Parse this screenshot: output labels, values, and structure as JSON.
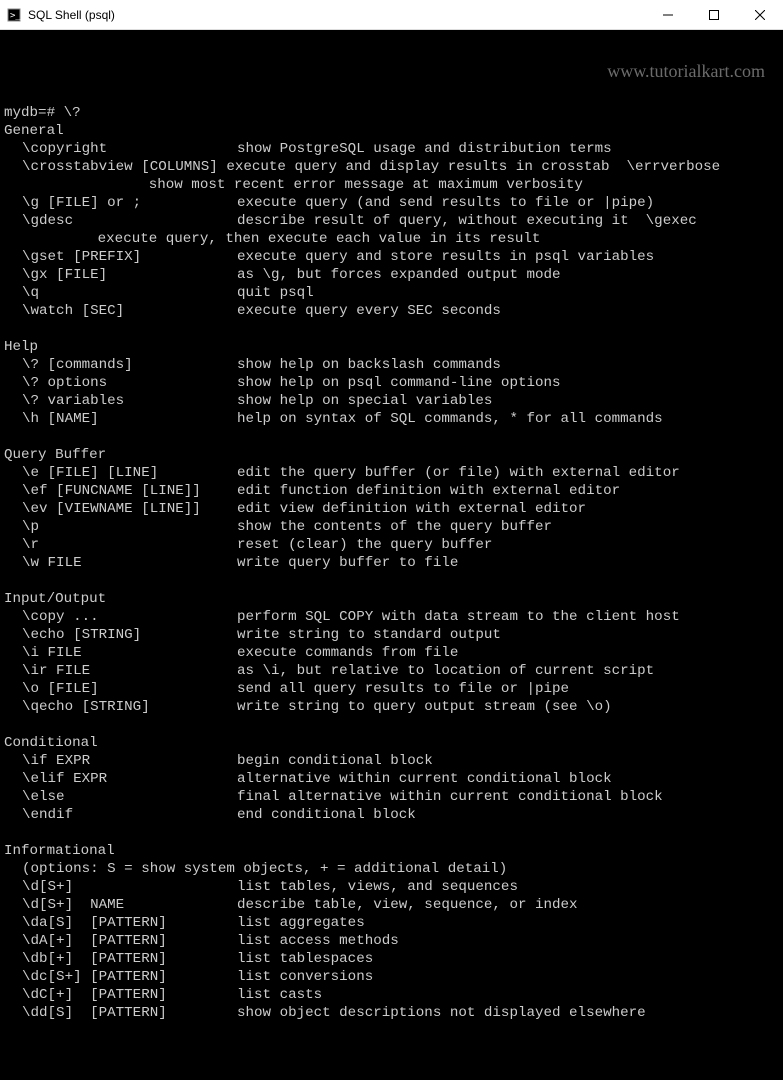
{
  "window": {
    "title": "SQL Shell (psql)"
  },
  "watermark": "www.tutorialkart.com",
  "prompt": "mydb=# \\?",
  "sections": [
    {
      "title": "General",
      "items": [
        {
          "cmd": "\\copyright",
          "desc": "show PostgreSQL usage and distribution terms"
        },
        {
          "cmd": "\\crosstabview [COLUMNS]",
          "desc": "execute query and display results in crosstab  \\errverbose",
          "nogap": true
        },
        {
          "cmd": "",
          "desc": "      show most recent error message at maximum verbosity",
          "continuation": true
        },
        {
          "cmd": "\\g [FILE] or ;",
          "desc": "execute query (and send results to file or |pipe)"
        },
        {
          "cmd": "\\gdesc",
          "desc": "describe result of query, without executing it  \\gexec"
        },
        {
          "cmd": "",
          "desc": "execute query, then execute each value in its result",
          "continuation": true
        },
        {
          "cmd": "\\gset [PREFIX]",
          "desc": "execute query and store results in psql variables"
        },
        {
          "cmd": "\\gx [FILE]",
          "desc": "as \\g, but forces expanded output mode"
        },
        {
          "cmd": "\\q",
          "desc": "quit psql"
        },
        {
          "cmd": "\\watch [SEC]",
          "desc": "execute query every SEC seconds"
        }
      ]
    },
    {
      "title": "Help",
      "items": [
        {
          "cmd": "\\? [commands]",
          "desc": "show help on backslash commands"
        },
        {
          "cmd": "\\? options",
          "desc": "show help on psql command-line options"
        },
        {
          "cmd": "\\? variables",
          "desc": "show help on special variables"
        },
        {
          "cmd": "\\h [NAME]",
          "desc": "help on syntax of SQL commands, * for all commands"
        }
      ]
    },
    {
      "title": "Query Buffer",
      "items": [
        {
          "cmd": "\\e [FILE] [LINE]",
          "desc": "edit the query buffer (or file) with external editor"
        },
        {
          "cmd": "\\ef [FUNCNAME [LINE]]",
          "desc": "edit function definition with external editor"
        },
        {
          "cmd": "\\ev [VIEWNAME [LINE]]",
          "desc": "edit view definition with external editor"
        },
        {
          "cmd": "\\p",
          "desc": "show the contents of the query buffer"
        },
        {
          "cmd": "\\r",
          "desc": "reset (clear) the query buffer"
        },
        {
          "cmd": "\\w FILE",
          "desc": "write query buffer to file"
        }
      ]
    },
    {
      "title": "Input/Output",
      "items": [
        {
          "cmd": "\\copy ...",
          "desc": "perform SQL COPY with data stream to the client host"
        },
        {
          "cmd": "\\echo [STRING]",
          "desc": "write string to standard output"
        },
        {
          "cmd": "\\i FILE",
          "desc": "execute commands from file"
        },
        {
          "cmd": "\\ir FILE",
          "desc": "as \\i, but relative to location of current script"
        },
        {
          "cmd": "\\o [FILE]",
          "desc": "send all query results to file or |pipe"
        },
        {
          "cmd": "\\qecho [STRING]",
          "desc": "write string to query output stream (see \\o)"
        }
      ]
    },
    {
      "title": "Conditional",
      "items": [
        {
          "cmd": "\\if EXPR",
          "desc": "begin conditional block"
        },
        {
          "cmd": "\\elif EXPR",
          "desc": "alternative within current conditional block"
        },
        {
          "cmd": "\\else",
          "desc": "final alternative within current conditional block"
        },
        {
          "cmd": "\\endif",
          "desc": "end conditional block"
        }
      ]
    },
    {
      "title": "Informational",
      "note": "(options: S = show system objects, + = additional detail)",
      "items": [
        {
          "cmd": "\\d[S+]",
          "desc": "list tables, views, and sequences"
        },
        {
          "cmd": "\\d[S+]  NAME",
          "desc": "describe table, view, sequence, or index"
        },
        {
          "cmd": "\\da[S]  [PATTERN]",
          "desc": "list aggregates"
        },
        {
          "cmd": "\\dA[+]  [PATTERN]",
          "desc": "list access methods"
        },
        {
          "cmd": "\\db[+]  [PATTERN]",
          "desc": "list tablespaces"
        },
        {
          "cmd": "\\dc[S+] [PATTERN]",
          "desc": "list conversions"
        },
        {
          "cmd": "\\dC[+]  [PATTERN]",
          "desc": "list casts"
        },
        {
          "cmd": "\\dd[S]  [PATTERN]",
          "desc": "show object descriptions not displayed elsewhere"
        }
      ]
    }
  ]
}
